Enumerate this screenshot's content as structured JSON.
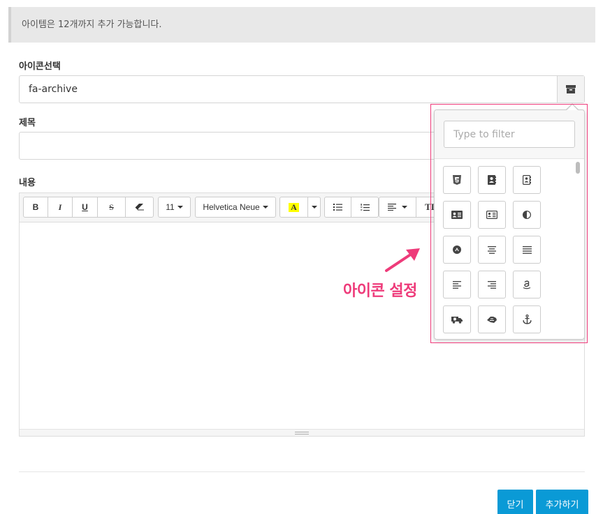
{
  "notice": {
    "text": "아이템은 12개까지 추가 가능합니다."
  },
  "icon_select": {
    "label": "아이콘선택",
    "value": "fa-archive",
    "addon_icon": "archive-icon"
  },
  "title_field": {
    "label": "제목",
    "value": "",
    "placeholder": ""
  },
  "content_field": {
    "label": "내용"
  },
  "toolbar": {
    "bold": "B",
    "italic": "I",
    "underline": "U",
    "strike": "S",
    "eraser_icon": "eraser-icon",
    "font_size": "11",
    "font_family": "Helvetica Neue",
    "color_letter": "A",
    "color_highlight": "#ffff00",
    "ul_icon": "unordered-list-icon",
    "ol_icon": "ordered-list-icon",
    "align_icon": "align-left-icon",
    "text_height": "TI"
  },
  "picker": {
    "filter_placeholder": "Type to filter",
    "icons": [
      "html5-icon",
      "address-book-icon",
      "address-book-o-icon",
      "address-card-icon",
      "address-card-o-icon",
      "adjust-icon",
      "adn-icon",
      "align-center-icon",
      "align-justify-icon",
      "align-left-icon",
      "align-right-icon",
      "amazon-icon",
      "ambulance-icon",
      "american-sign-language-icon",
      "anchor-icon"
    ]
  },
  "annotation": {
    "text": "아이콘 설정",
    "color": "#ee3b7a"
  },
  "footer": {
    "close_label": "닫기",
    "add_label": "추가하기"
  },
  "colors": {
    "primary": "#0a9ad6",
    "notice_bg": "#e8e8e8"
  }
}
